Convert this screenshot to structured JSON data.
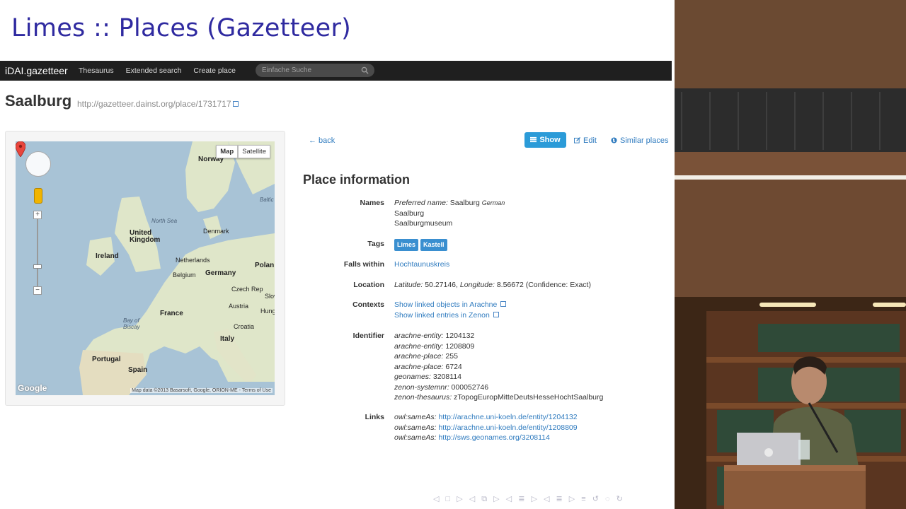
{
  "slide": {
    "title": "Limes :: Places (Gazetteer)"
  },
  "navbar": {
    "brand": "iDAI.gazetteer",
    "items": [
      "Thesaurus",
      "Extended search",
      "Create place"
    ],
    "search_placeholder": "Einfache Suche"
  },
  "place": {
    "name": "Saalburg",
    "url": "http://gazetteer.dainst.org/place/1731717"
  },
  "map": {
    "toggle": [
      "Map",
      "Satellite"
    ],
    "active_toggle": "Map",
    "labels": {
      "norway": "Norway",
      "north_sea": "North Sea",
      "baltic": "Baltic",
      "denmark": "Denmark",
      "uk": "United Kingdom",
      "ireland": "Ireland",
      "netherlands": "Netherlands",
      "belgium": "Belgium",
      "germany": "Germany",
      "poland": "Polan",
      "czech": "Czech Rep",
      "slovakia": "Slov",
      "austria": "Austria",
      "hungary": "Hung",
      "france": "France",
      "bay": "Bay of\nBiscay",
      "croatia": "Croatia",
      "italy": "Italy",
      "portugal": "Portugal",
      "spain": "Spain"
    },
    "footer": "Map data ©2013 Basarsoft, Google, ORION-ME - Terms of Use",
    "logo": "Google"
  },
  "actions": {
    "back": "← back",
    "show": "Show",
    "edit": "Edit",
    "similar": "Similar places"
  },
  "info": {
    "heading": "Place information",
    "names_label": "Names",
    "names": {
      "preferred_prefix": "Preferred name:",
      "preferred": "Saalburg",
      "preferred_lang": "German",
      "alt1": "Saalburg",
      "alt2": "Saalburgmuseum"
    },
    "tags_label": "Tags",
    "tags": [
      "Limes",
      "Kastell"
    ],
    "falls_label": "Falls within",
    "falls": "Hochtaunuskreis",
    "location_label": "Location",
    "location": {
      "lat_label": "Latitude:",
      "lat": "50.27146,",
      "lon_label": "Longitude:",
      "lon": "8.56672",
      "conf_label": "(Confidence:",
      "conf": "Exact)"
    },
    "contexts_label": "Contexts",
    "contexts": [
      "Show linked objects in Arachne",
      "Show linked entries in Zenon"
    ],
    "identifier_label": "Identifier",
    "identifiers": [
      {
        "k": "arachne-entity:",
        "v": "1204132"
      },
      {
        "k": "arachne-entity:",
        "v": "1208809"
      },
      {
        "k": "arachne-place:",
        "v": "255"
      },
      {
        "k": "arachne-place:",
        "v": "6724"
      },
      {
        "k": "geonames:",
        "v": "3208114"
      },
      {
        "k": "zenon-systemnr:",
        "v": "000052746"
      },
      {
        "k": "zenon-thesaurus:",
        "v": "zTopogEuropMitteDeutsHesseHochtSaalburg"
      }
    ],
    "links_label": "Links",
    "links": [
      {
        "k": "owl:sameAs:",
        "v": "http://arachne.uni-koeln.de/entity/1204132"
      },
      {
        "k": "owl:sameAs:",
        "v": "http://arachne.uni-koeln.de/entity/1208809"
      },
      {
        "k": "owl:sameAs:",
        "v": "http://sws.geonames.org/3208114"
      }
    ]
  },
  "beamer_nav": "◁ □ ▷ ◁ ⧉ ▷ ◁ ≣ ▷ ◁ ≣ ▷ ≡ ↺ ◌ ↻"
}
